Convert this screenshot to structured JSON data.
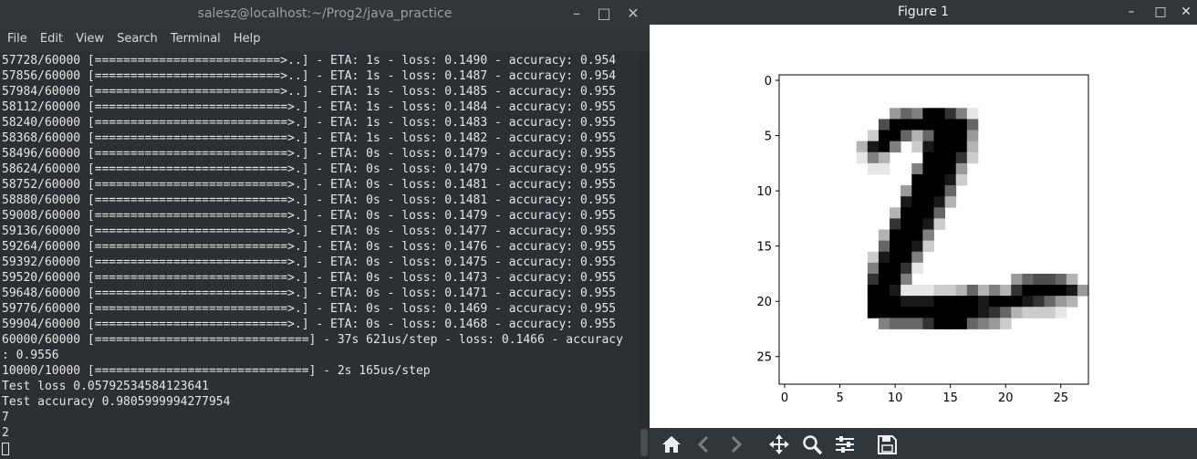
{
  "terminal": {
    "title": "salesz@localhost:~/Prog2/java_practice",
    "menu": [
      "File",
      "Edit",
      "View",
      "Search",
      "Terminal",
      "Help"
    ],
    "lines": [
      "57728/60000 [==========================>..] - ETA: 1s - loss: 0.1490 - accuracy: 0.954",
      "57856/60000 [==========================>..] - ETA: 1s - loss: 0.1487 - accuracy: 0.954",
      "57984/60000 [==========================>..] - ETA: 1s - loss: 0.1485 - accuracy: 0.955",
      "58112/60000 [===========================>.] - ETA: 1s - loss: 0.1484 - accuracy: 0.955",
      "58240/60000 [===========================>.] - ETA: 1s - loss: 0.1483 - accuracy: 0.955",
      "58368/60000 [===========================>.] - ETA: 1s - loss: 0.1482 - accuracy: 0.955",
      "58496/60000 [===========================>.] - ETA: 0s - loss: 0.1479 - accuracy: 0.955",
      "58624/60000 [===========================>.] - ETA: 0s - loss: 0.1479 - accuracy: 0.955",
      "58752/60000 [===========================>.] - ETA: 0s - loss: 0.1481 - accuracy: 0.955",
      "58880/60000 [===========================>.] - ETA: 0s - loss: 0.1481 - accuracy: 0.955",
      "59008/60000 [===========================>.] - ETA: 0s - loss: 0.1479 - accuracy: 0.955",
      "59136/60000 [===========================>.] - ETA: 0s - loss: 0.1477 - accuracy: 0.955",
      "59264/60000 [===========================>.] - ETA: 0s - loss: 0.1476 - accuracy: 0.955",
      "59392/60000 [===========================>.] - ETA: 0s - loss: 0.1475 - accuracy: 0.955",
      "59520/60000 [===========================>.] - ETA: 0s - loss: 0.1473 - accuracy: 0.955",
      "59648/60000 [===========================>.] - ETA: 0s - loss: 0.1471 - accuracy: 0.955",
      "59776/60000 [===========================>.] - ETA: 0s - loss: 0.1469 - accuracy: 0.955",
      "59904/60000 [===========================>.] - ETA: 0s - loss: 0.1468 - accuracy: 0.955",
      "60000/60000 [==============================] - 37s 621us/step - loss: 0.1466 - accuracy",
      ": 0.9556",
      "10000/10000 [==============================] - 2s 165us/step",
      "Test loss 0.05792534584123641",
      "Test accuracy 0.9805999994277954",
      "7",
      "2"
    ]
  },
  "figure": {
    "title": "Figure 1",
    "toolbar_icons": [
      "home-icon",
      "back-icon",
      "forward-icon",
      "pan-icon",
      "zoom-icon",
      "configure-subplots-icon",
      "save-icon"
    ]
  },
  "chart_data": {
    "type": "heatmap",
    "title": "",
    "xlabel": "",
    "ylabel": "",
    "rows": 28,
    "cols": 28,
    "x_ticks": [
      "0",
      "5",
      "10",
      "15",
      "20",
      "25"
    ],
    "y_ticks": [
      "0",
      "5",
      "10",
      "15",
      "20",
      "25"
    ],
    "colormap": "gray_r",
    "nonzero_cells": [
      [
        3,
        10,
        0.4
      ],
      [
        3,
        11,
        0.6
      ],
      [
        3,
        12,
        0.5
      ],
      [
        3,
        13,
        1
      ],
      [
        3,
        14,
        1
      ],
      [
        3,
        15,
        0.8
      ],
      [
        3,
        16,
        0.5
      ],
      [
        3,
        17,
        0.1
      ],
      [
        4,
        9,
        0.7
      ],
      [
        4,
        10,
        1
      ],
      [
        4,
        11,
        1
      ],
      [
        4,
        12,
        1
      ],
      [
        4,
        13,
        1
      ],
      [
        4,
        14,
        1
      ],
      [
        4,
        15,
        1
      ],
      [
        4,
        16,
        1
      ],
      [
        4,
        17,
        0.6
      ],
      [
        5,
        8,
        0.2
      ],
      [
        5,
        9,
        1
      ],
      [
        5,
        10,
        1
      ],
      [
        5,
        11,
        0.6
      ],
      [
        5,
        12,
        0.3
      ],
      [
        5,
        13,
        0.6
      ],
      [
        5,
        14,
        1
      ],
      [
        5,
        15,
        1
      ],
      [
        5,
        16,
        1
      ],
      [
        5,
        17,
        0.4
      ],
      [
        6,
        7,
        0.3
      ],
      [
        6,
        8,
        0.9
      ],
      [
        6,
        9,
        1
      ],
      [
        6,
        10,
        0.5
      ],
      [
        6,
        12,
        0.2
      ],
      [
        6,
        13,
        0.9
      ],
      [
        6,
        14,
        1
      ],
      [
        6,
        15,
        1
      ],
      [
        6,
        16,
        1
      ],
      [
        6,
        17,
        0.3
      ],
      [
        7,
        7,
        0.1
      ],
      [
        7,
        8,
        0.5
      ],
      [
        7,
        9,
        0.3
      ],
      [
        7,
        13,
        1
      ],
      [
        7,
        14,
        1
      ],
      [
        7,
        15,
        1
      ],
      [
        7,
        16,
        0.8
      ],
      [
        7,
        17,
        0.2
      ],
      [
        8,
        8,
        0.1
      ],
      [
        8,
        9,
        0.1
      ],
      [
        8,
        12,
        0.5
      ],
      [
        8,
        13,
        1
      ],
      [
        8,
        14,
        1
      ],
      [
        8,
        15,
        1
      ],
      [
        8,
        16,
        0.4
      ],
      [
        9,
        12,
        1
      ],
      [
        9,
        13,
        1
      ],
      [
        9,
        14,
        1
      ],
      [
        9,
        15,
        0.9
      ],
      [
        9,
        16,
        0.2
      ],
      [
        10,
        11,
        0.4
      ],
      [
        10,
        12,
        1
      ],
      [
        10,
        13,
        1
      ],
      [
        10,
        14,
        1
      ],
      [
        10,
        15,
        0.6
      ],
      [
        11,
        11,
        0.9
      ],
      [
        11,
        12,
        1
      ],
      [
        11,
        13,
        1
      ],
      [
        11,
        14,
        0.9
      ],
      [
        11,
        15,
        0.3
      ],
      [
        12,
        10,
        0.3
      ],
      [
        12,
        11,
        1
      ],
      [
        12,
        12,
        1
      ],
      [
        12,
        13,
        1
      ],
      [
        12,
        14,
        0.6
      ],
      [
        13,
        10,
        0.8
      ],
      [
        13,
        11,
        1
      ],
      [
        13,
        12,
        1
      ],
      [
        13,
        13,
        0.9
      ],
      [
        13,
        14,
        0.2
      ],
      [
        14,
        9,
        0.3
      ],
      [
        14,
        10,
        1
      ],
      [
        14,
        11,
        1
      ],
      [
        14,
        12,
        1
      ],
      [
        14,
        13,
        0.5
      ],
      [
        15,
        9,
        0.6
      ],
      [
        15,
        10,
        1
      ],
      [
        15,
        11,
        1
      ],
      [
        15,
        12,
        0.9
      ],
      [
        15,
        13,
        0.2
      ],
      [
        16,
        8,
        0.2
      ],
      [
        16,
        9,
        0.9
      ],
      [
        16,
        10,
        1
      ],
      [
        16,
        11,
        1
      ],
      [
        16,
        12,
        0.5
      ],
      [
        17,
        8,
        0.5
      ],
      [
        17,
        9,
        1
      ],
      [
        17,
        10,
        1
      ],
      [
        17,
        11,
        0.8
      ],
      [
        17,
        12,
        0.1
      ],
      [
        18,
        8,
        0.8
      ],
      [
        18,
        9,
        1
      ],
      [
        18,
        10,
        1
      ],
      [
        18,
        11,
        0.5
      ],
      [
        18,
        21,
        0.4
      ],
      [
        18,
        22,
        0.6
      ],
      [
        18,
        23,
        0.7
      ],
      [
        18,
        24,
        0.7
      ],
      [
        18,
        25,
        0.6
      ],
      [
        18,
        26,
        0.3
      ],
      [
        19,
        8,
        1
      ],
      [
        19,
        9,
        1
      ],
      [
        19,
        10,
        0.9
      ],
      [
        19,
        11,
        0.1
      ],
      [
        19,
        12,
        0.1
      ],
      [
        19,
        13,
        0.1
      ],
      [
        19,
        14,
        0.2
      ],
      [
        19,
        15,
        0.2
      ],
      [
        19,
        16,
        0.3
      ],
      [
        19,
        17,
        0.6
      ],
      [
        19,
        18,
        0.3
      ],
      [
        19,
        19,
        0.5
      ],
      [
        19,
        20,
        0.3
      ],
      [
        19,
        21,
        0.8
      ],
      [
        19,
        22,
        1
      ],
      [
        19,
        23,
        1
      ],
      [
        19,
        24,
        1
      ],
      [
        19,
        25,
        1
      ],
      [
        19,
        26,
        0.9
      ],
      [
        19,
        27,
        0.4
      ],
      [
        20,
        8,
        1
      ],
      [
        20,
        9,
        1
      ],
      [
        20,
        10,
        1
      ],
      [
        20,
        11,
        0.9
      ],
      [
        20,
        12,
        0.9
      ],
      [
        20,
        13,
        0.9
      ],
      [
        20,
        14,
        1
      ],
      [
        20,
        15,
        1
      ],
      [
        20,
        16,
        1
      ],
      [
        20,
        17,
        1
      ],
      [
        20,
        18,
        0.9
      ],
      [
        20,
        19,
        1
      ],
      [
        20,
        20,
        1
      ],
      [
        20,
        21,
        1
      ],
      [
        20,
        22,
        0.9
      ],
      [
        20,
        23,
        0.8
      ],
      [
        20,
        24,
        0.6
      ],
      [
        20,
        25,
        0.4
      ],
      [
        20,
        26,
        0.3
      ],
      [
        21,
        8,
        1
      ],
      [
        21,
        9,
        1
      ],
      [
        21,
        10,
        1
      ],
      [
        21,
        11,
        1
      ],
      [
        21,
        12,
        1
      ],
      [
        21,
        13,
        1
      ],
      [
        21,
        14,
        1
      ],
      [
        21,
        15,
        1
      ],
      [
        21,
        16,
        1
      ],
      [
        21,
        17,
        1
      ],
      [
        21,
        18,
        0.9
      ],
      [
        21,
        19,
        0.8
      ],
      [
        21,
        20,
        0.6
      ],
      [
        21,
        21,
        0.3
      ],
      [
        21,
        22,
        0.2
      ],
      [
        21,
        23,
        0.2
      ],
      [
        21,
        24,
        0.2
      ],
      [
        21,
        25,
        0.1
      ],
      [
        22,
        9,
        0.5
      ],
      [
        22,
        10,
        0.6
      ],
      [
        22,
        11,
        0.6
      ],
      [
        22,
        12,
        0.6
      ],
      [
        22,
        13,
        0.8
      ],
      [
        22,
        14,
        1
      ],
      [
        22,
        15,
        1
      ],
      [
        22,
        16,
        1
      ],
      [
        22,
        17,
        0.6
      ],
      [
        22,
        18,
        0.5
      ],
      [
        22,
        19,
        0.4
      ],
      [
        22,
        20,
        0.2
      ]
    ]
  }
}
